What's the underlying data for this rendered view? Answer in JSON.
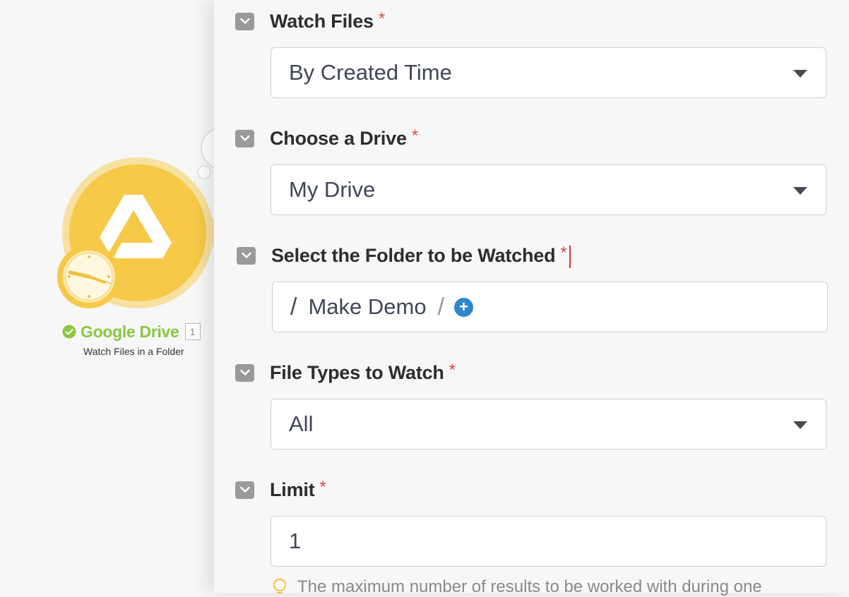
{
  "module": {
    "title": "Google Drive",
    "badge": "1",
    "subtitle": "Watch Files in a Folder",
    "icons": [
      "google-drive-icon",
      "clock-icon",
      "check-circle-icon"
    ],
    "colors": {
      "module_fill": "#f7c948",
      "module_halo": "#f6e1a0",
      "title_green": "#8cc63f"
    }
  },
  "fields": {
    "watch_files": {
      "label": "Watch Files",
      "required": "*",
      "value": "By Created Time"
    },
    "drive": {
      "label": "Choose a Drive",
      "required": "*",
      "value": "My Drive"
    },
    "folder": {
      "label": "Select the Folder to be Watched",
      "required": "*",
      "path_sep": "/",
      "value": "Make Demo",
      "trail_sep": "/",
      "add_symbol": "+"
    },
    "file_types": {
      "label": "File Types to Watch",
      "required": "*",
      "value": "All"
    },
    "limit": {
      "label": "Limit",
      "required": "*",
      "value": "1",
      "note": "The maximum number of results to be worked with during one"
    }
  },
  "colors": {
    "required": "#dd4b4b",
    "add_button": "#2f86c8",
    "collapse_button": "#9a9a9a"
  }
}
